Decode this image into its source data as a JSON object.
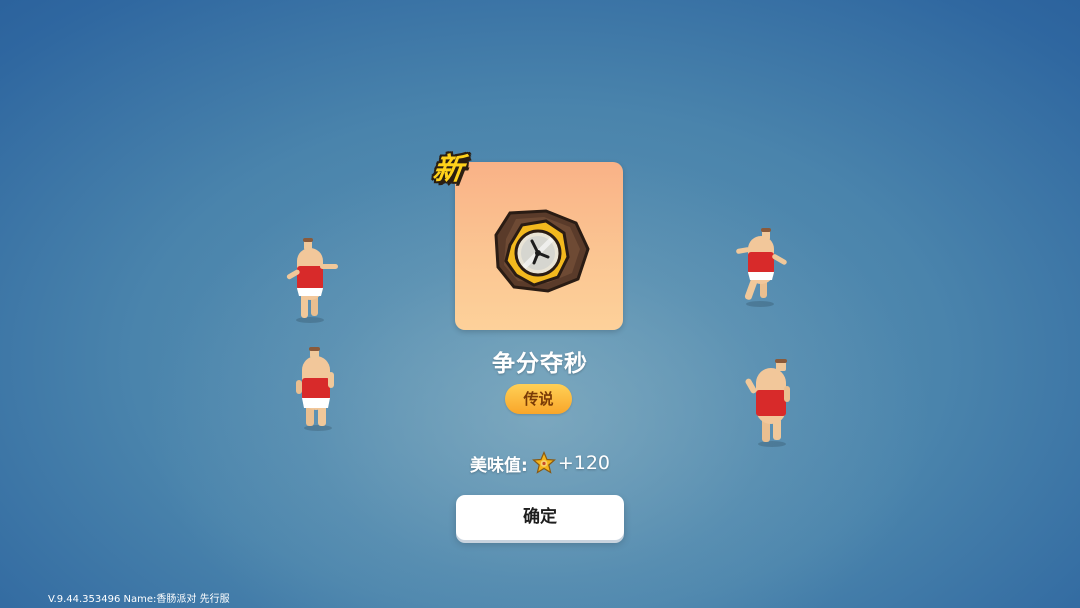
{
  "reward": {
    "new_badge": "新",
    "item_name": "争分夺秒",
    "rarity": "传说",
    "taste_label": "美味值:",
    "taste_value": "+120",
    "icon": "clock-icon",
    "star_icon": "star-icon"
  },
  "buttons": {
    "confirm_label": "确定"
  },
  "footer": {
    "version_text": "V.9.44.353496 Name:香肠派对 先行服"
  },
  "colors": {
    "card_top": "#f9b287",
    "card_bottom": "#fdd19a",
    "rarity_badge": "#fbb43a",
    "new_badge": "#ffd21a",
    "background": "#3f7aa8"
  },
  "characters": [
    "sausage-character",
    "sausage-character",
    "sausage-character",
    "sausage-character"
  ]
}
